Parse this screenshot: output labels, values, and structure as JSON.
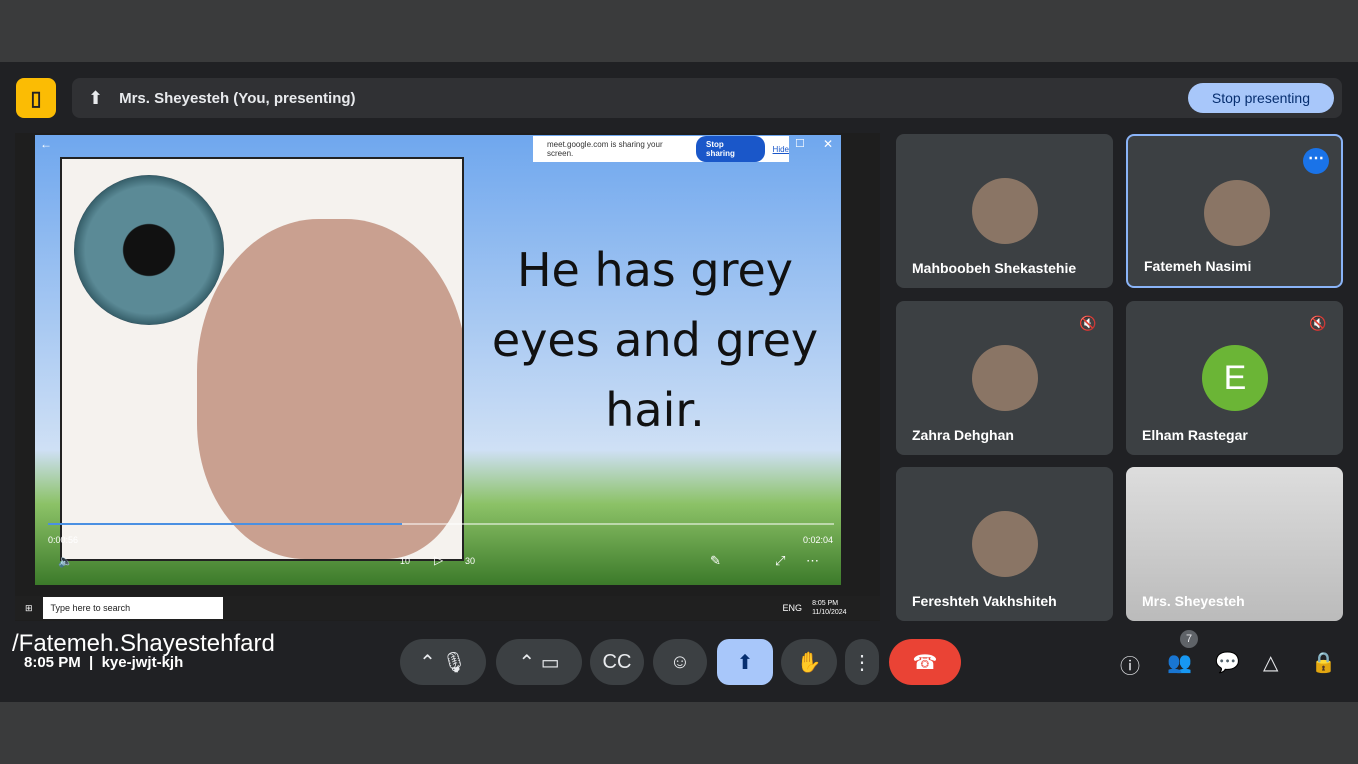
{
  "header": {
    "presenter_label": "Mrs. Sheyesteh (You, presenting)",
    "stop_presenting": "Stop presenting"
  },
  "slide": {
    "text": "He has grey eyes and grey hair.",
    "time_current": "0:00:56",
    "time_total": "0:02:04",
    "progress": 0.45,
    "rewind_label": "10",
    "forward_label": "30"
  },
  "share_banner": {
    "text": "meet.google.com is sharing your screen.",
    "stop_sharing": "Stop sharing",
    "hide": "Hide"
  },
  "taskbar": {
    "search_placeholder": "Type here to search",
    "time": "8:05 PM",
    "date": "11/10/2024",
    "lang": "ENG"
  },
  "participants": [
    {
      "name": "Mahboobeh Shekastehie",
      "muted": false
    },
    {
      "name": "Fatemeh Nasimi",
      "muted": false,
      "active": true
    },
    {
      "name": "Zahra Dehghan",
      "muted": true
    },
    {
      "name": "Elham Rastegar",
      "muted": true,
      "initial": "E",
      "color": "#6bb536"
    },
    {
      "name": "Fereshteh Vakhshiteh",
      "muted": false
    },
    {
      "name": "Mrs. Sheyesteh",
      "muted": false
    }
  ],
  "footer": {
    "watermark": "/Fatemeh.Shayestehfard",
    "time": "8:05 PM",
    "meeting_code": "kye-jwjt-kjh",
    "people_count": "7"
  }
}
